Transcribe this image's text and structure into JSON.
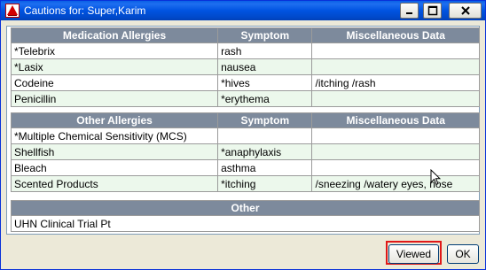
{
  "window": {
    "title": "Cautions for: Super,Karim"
  },
  "medication_allergies": {
    "headers": [
      "Medication Allergies",
      "Symptom",
      "Miscellaneous Data"
    ],
    "rows": [
      [
        "*Telebrix",
        "rash",
        ""
      ],
      [
        "*Lasix",
        "nausea",
        ""
      ],
      [
        "Codeine",
        "*hives",
        "/itching /rash"
      ],
      [
        "Penicillin",
        "*erythema",
        ""
      ]
    ]
  },
  "other_allergies": {
    "headers": [
      "Other Allergies",
      "Symptom",
      "Miscellaneous Data"
    ],
    "rows": [
      [
        "*Multiple Chemical Sensitivity (MCS)",
        "",
        ""
      ],
      [
        "Shellfish",
        "*anaphylaxis",
        ""
      ],
      [
        "Bleach",
        "asthma",
        ""
      ],
      [
        "Scented Products",
        "*itching",
        "/sneezing /watery eyes, nose"
      ]
    ]
  },
  "other": {
    "header": "Other",
    "rows": [
      "UHN Clinical Trial Pt"
    ]
  },
  "footer": {
    "viewed_label": "Viewed",
    "ok_label": "OK"
  },
  "colors": {
    "titlebar": "#0053e1",
    "header_bg": "#7d8a9c",
    "row_alt": "#ecf8ec",
    "highlight": "#e01818"
  }
}
